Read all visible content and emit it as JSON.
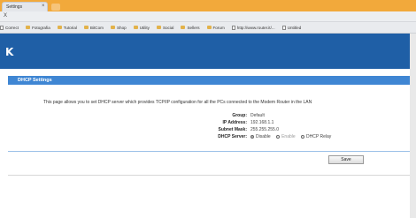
{
  "browser": {
    "tab_label": "Settings",
    "tab_close": "×",
    "address": "X",
    "bookmarks": [
      {
        "label": "Correct",
        "icon": "page"
      },
      {
        "label": "Fotografia",
        "icon": "folder"
      },
      {
        "label": "Tutorial",
        "icon": "folder"
      },
      {
        "label": "BitCom",
        "icon": "folder"
      },
      {
        "label": "Shop",
        "icon": "folder"
      },
      {
        "label": "Utility",
        "icon": "folder"
      },
      {
        "label": "Social",
        "icon": "folder"
      },
      {
        "label": "Sellers",
        "icon": "folder"
      },
      {
        "label": "Forum",
        "icon": "folder"
      },
      {
        "label": "http://www.router.it/...",
        "icon": "page"
      },
      {
        "label": "Untitled",
        "icon": "page"
      }
    ]
  },
  "header": {
    "logo": "K"
  },
  "section": {
    "title": "DHCP Settings"
  },
  "description": "This page allows you to set DHCP server which provides TCP/IP configuration for all the PCs connected to the Modem Router in the LAN",
  "form": {
    "group": {
      "label": "Group:",
      "value": "Default"
    },
    "ip": {
      "label": "IP Address:",
      "value": "192.168.1.1"
    },
    "mask": {
      "label": "Subnet Mask:",
      "value": "255.255.255.0"
    },
    "dhcp": {
      "label": "DHCP Server:",
      "options": [
        "Disable",
        "Enable",
        "DHCP Relay"
      ],
      "selected": "Disable"
    }
  },
  "buttons": {
    "save": "Save"
  },
  "colors": {
    "header": "#1f5fa6",
    "section_bar": "#3f86d3",
    "tab_bar": "#f2a93b"
  }
}
